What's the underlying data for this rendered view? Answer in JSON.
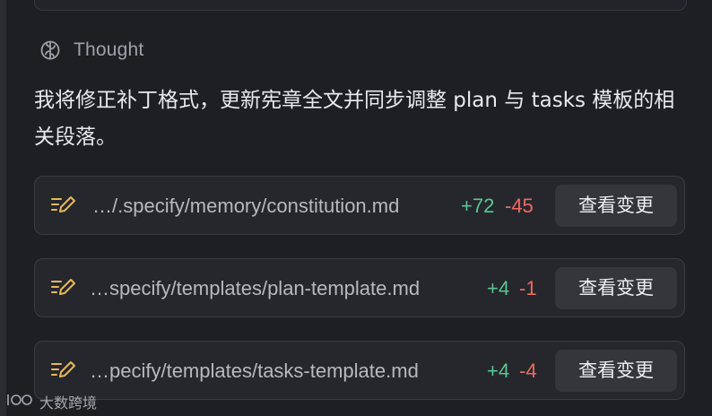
{
  "thought": {
    "label": "Thought",
    "icon": "brain-icon"
  },
  "message": {
    "text": "我将修正补丁格式，更新宪章全文并同步调整 plan 与 tasks 模板的相关段落。"
  },
  "files": [
    {
      "path": "…/.specify/memory/constitution.md",
      "additions": "+72",
      "deletions": "-45",
      "button_label": "查看变更",
      "icon": "edit-icon"
    },
    {
      "path": "…specify/templates/plan-template.md",
      "additions": "+4",
      "deletions": "-1",
      "button_label": "查看变更",
      "icon": "edit-icon"
    },
    {
      "path": "…pecify/templates/tasks-template.md",
      "additions": "+4",
      "deletions": "-4",
      "button_label": "查看变更",
      "icon": "edit-icon"
    }
  ],
  "watermark": {
    "text": "大数跨境"
  },
  "colors": {
    "background": "#1e1f23",
    "card": "#25272c",
    "additions": "#57c792",
    "deletions": "#ef6a61",
    "edit_icon": "#e7b95a"
  }
}
